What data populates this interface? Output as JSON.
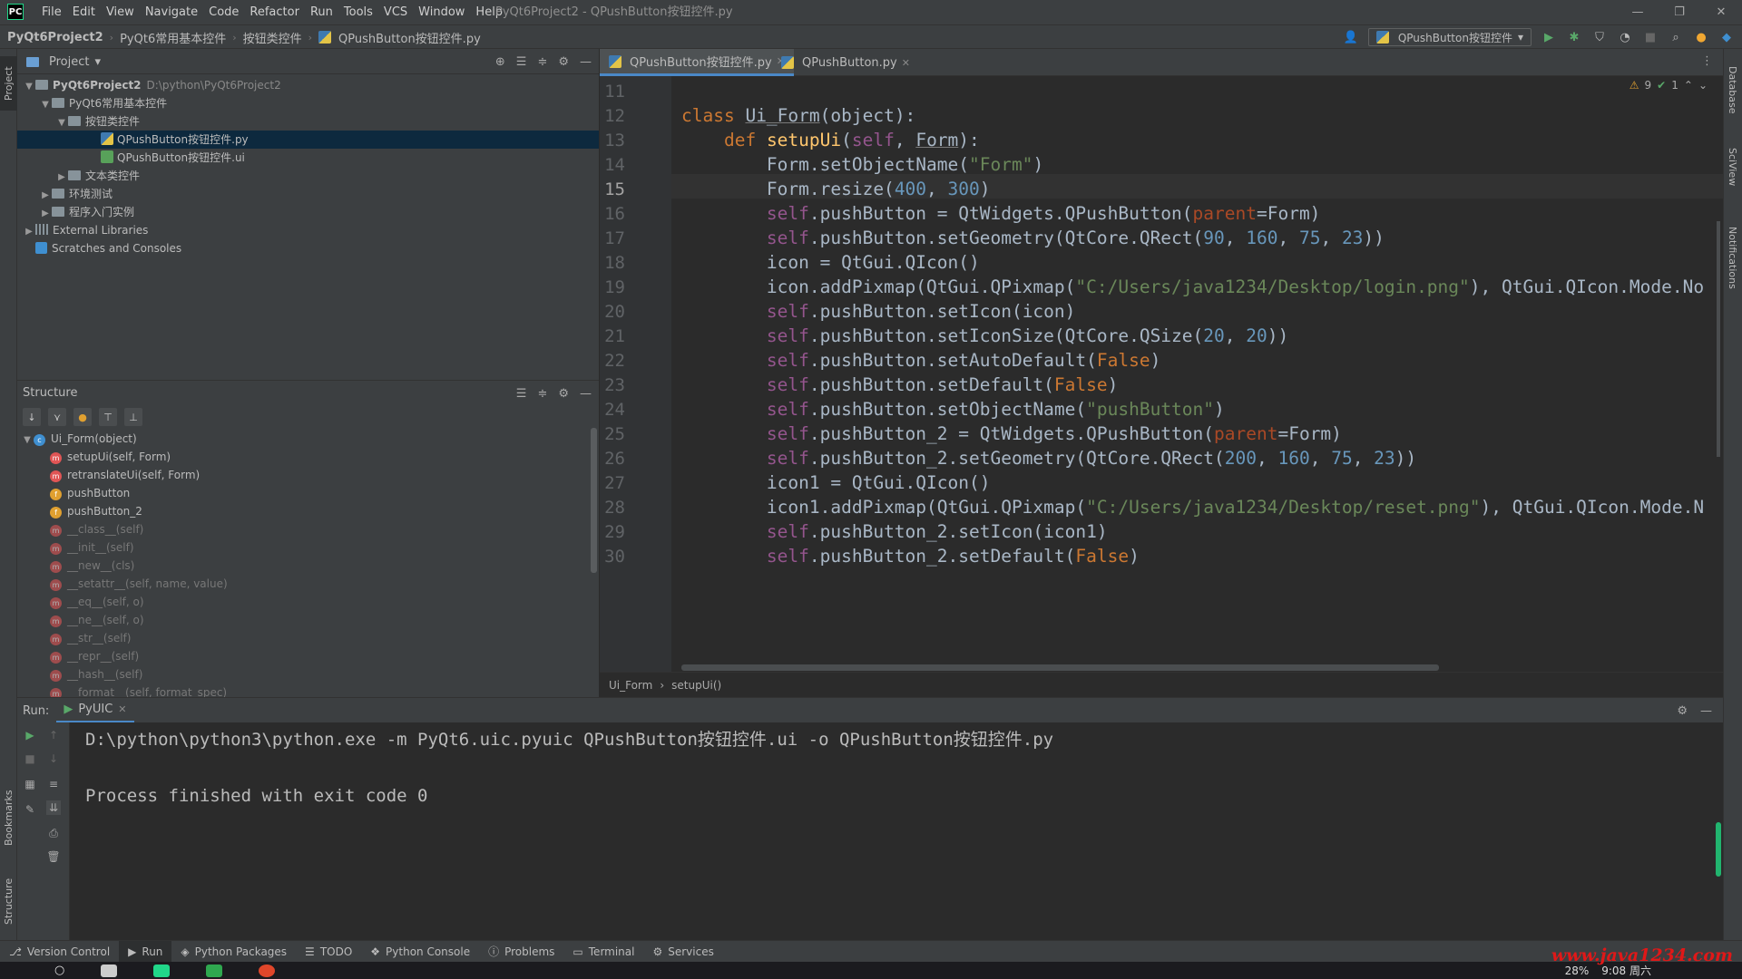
{
  "app": {
    "logo": "PC",
    "menu": [
      "File",
      "Edit",
      "View",
      "Navigate",
      "Code",
      "Refactor",
      "Run",
      "Tools",
      "VCS",
      "Window",
      "Help"
    ],
    "window_title": "PyQt6Project2 - QPushButton按钮控件.py",
    "win_controls": [
      "—",
      "❐",
      "✕"
    ]
  },
  "nav": {
    "breadcrumb": [
      "PyQt6Project2",
      "PyQt6常用基本控件",
      "按钮类控件",
      "QPushButton按钮控件.py"
    ],
    "run_config": "QPushButton按钮控件"
  },
  "project_panel": {
    "title": "Project",
    "tree": [
      {
        "label": "PyQt6Project2",
        "path": "D:\\python\\PyQt6Project2",
        "type": "folder",
        "indent": 0,
        "expanded": true,
        "bold": true
      },
      {
        "label": "PyQt6常用基本控件",
        "type": "folder",
        "indent": 1,
        "expanded": true
      },
      {
        "label": "按钮类控件",
        "type": "folder",
        "indent": 2,
        "expanded": true
      },
      {
        "label": "QPushButton按钮控件.py",
        "type": "py",
        "indent": 4,
        "selected": true
      },
      {
        "label": "QPushButton按钮控件.ui",
        "type": "ui",
        "indent": 4
      },
      {
        "label": "文本类控件",
        "type": "folder",
        "indent": 2,
        "expanded": false
      },
      {
        "label": "环境测试",
        "type": "folder",
        "indent": 1,
        "expanded": false
      },
      {
        "label": "程序入门实例",
        "type": "folder",
        "indent": 1,
        "expanded": false
      },
      {
        "label": "External Libraries",
        "type": "lib",
        "indent": 0,
        "expanded": false
      },
      {
        "label": "Scratches and Consoles",
        "type": "scratch",
        "indent": 0
      }
    ]
  },
  "structure_panel": {
    "title": "Structure",
    "items": [
      {
        "label": "Ui_Form(object)",
        "kind": "c",
        "indent": 0,
        "dim": false
      },
      {
        "label": "setupUi(self, Form)",
        "kind": "m",
        "indent": 1,
        "dim": false
      },
      {
        "label": "retranslateUi(self, Form)",
        "kind": "m",
        "indent": 1,
        "dim": false
      },
      {
        "label": "pushButton",
        "kind": "f",
        "indent": 1,
        "dim": false
      },
      {
        "label": "pushButton_2",
        "kind": "f",
        "indent": 1,
        "dim": false
      },
      {
        "label": "__class__(self)",
        "kind": "m",
        "indent": 1,
        "dim": true
      },
      {
        "label": "__init__(self)",
        "kind": "m",
        "indent": 1,
        "dim": true
      },
      {
        "label": "__new__(cls)",
        "kind": "m",
        "indent": 1,
        "dim": true
      },
      {
        "label": "__setattr__(self, name, value)",
        "kind": "m",
        "indent": 1,
        "dim": true
      },
      {
        "label": "__eq__(self, o)",
        "kind": "m",
        "indent": 1,
        "dim": true
      },
      {
        "label": "__ne__(self, o)",
        "kind": "m",
        "indent": 1,
        "dim": true
      },
      {
        "label": "__str__(self)",
        "kind": "m",
        "indent": 1,
        "dim": true
      },
      {
        "label": "__repr__(self)",
        "kind": "m",
        "indent": 1,
        "dim": true
      },
      {
        "label": "__hash__(self)",
        "kind": "m",
        "indent": 1,
        "dim": true
      },
      {
        "label": "__format__(self, format_spec)",
        "kind": "m",
        "indent": 1,
        "dim": true
      }
    ]
  },
  "editor": {
    "tabs": [
      {
        "label": "QPushButton按钮控件.py",
        "active": true
      },
      {
        "label": "QPushButton.py",
        "active": false
      }
    ],
    "inspection": {
      "warnings": "9",
      "ok": "1"
    },
    "current_line": 15,
    "lines": [
      {
        "n": 11,
        "tokens": []
      },
      {
        "n": 12,
        "tokens": [
          [
            "kw",
            "class "
          ],
          [
            "ul",
            "Ui_Form"
          ],
          [
            "p",
            "(object):"
          ]
        ]
      },
      {
        "n": 13,
        "tokens": [
          [
            "p",
            "    "
          ],
          [
            "kw",
            "def "
          ],
          [
            "fn",
            "setupUi"
          ],
          [
            "p",
            "("
          ],
          [
            "self",
            "self"
          ],
          [
            "p",
            ", "
          ],
          [
            "ul",
            "Form"
          ],
          [
            "p",
            "):"
          ]
        ]
      },
      {
        "n": 14,
        "tokens": [
          [
            "p",
            "        Form.setObjectName("
          ],
          [
            "str",
            "\"Form\""
          ],
          [
            "p",
            ")"
          ]
        ]
      },
      {
        "n": 15,
        "tokens": [
          [
            "p",
            "        Form.resize("
          ],
          [
            "num",
            "400"
          ],
          [
            "p",
            ", "
          ],
          [
            "num",
            "300"
          ],
          [
            "p",
            ")"
          ]
        ]
      },
      {
        "n": 16,
        "tokens": [
          [
            "p",
            "        "
          ],
          [
            "self",
            "self"
          ],
          [
            "p",
            ".pushButton = QtWidgets.QPushButton("
          ],
          [
            "param",
            "parent"
          ],
          [
            "p",
            "=Form)"
          ]
        ]
      },
      {
        "n": 17,
        "tokens": [
          [
            "p",
            "        "
          ],
          [
            "self",
            "self"
          ],
          [
            "p",
            ".pushButton.setGeometry(QtCore.QRect("
          ],
          [
            "num",
            "90"
          ],
          [
            "p",
            ", "
          ],
          [
            "num",
            "160"
          ],
          [
            "p",
            ", "
          ],
          [
            "num",
            "75"
          ],
          [
            "p",
            ", "
          ],
          [
            "num",
            "23"
          ],
          [
            "p",
            "))"
          ]
        ]
      },
      {
        "n": 18,
        "tokens": [
          [
            "p",
            "        icon = QtGui.QIcon()"
          ]
        ]
      },
      {
        "n": 19,
        "tokens": [
          [
            "p",
            "        icon.addPixmap(QtGui.QPixmap("
          ],
          [
            "str",
            "\"C:/Users/java1234/Desktop/login.png\""
          ],
          [
            "p",
            "), QtGui.QIcon.Mode.No"
          ]
        ]
      },
      {
        "n": 20,
        "tokens": [
          [
            "p",
            "        "
          ],
          [
            "self",
            "self"
          ],
          [
            "p",
            ".pushButton.setIcon(icon)"
          ]
        ]
      },
      {
        "n": 21,
        "tokens": [
          [
            "p",
            "        "
          ],
          [
            "self",
            "self"
          ],
          [
            "p",
            ".pushButton.setIconSize(QtCore.QSize("
          ],
          [
            "num",
            "20"
          ],
          [
            "p",
            ", "
          ],
          [
            "num",
            "20"
          ],
          [
            "p",
            "))"
          ]
        ]
      },
      {
        "n": 22,
        "tokens": [
          [
            "p",
            "        "
          ],
          [
            "self",
            "self"
          ],
          [
            "p",
            ".pushButton.setAutoDefault("
          ],
          [
            "kw",
            "False"
          ],
          [
            "p",
            ")"
          ]
        ]
      },
      {
        "n": 23,
        "tokens": [
          [
            "p",
            "        "
          ],
          [
            "self",
            "self"
          ],
          [
            "p",
            ".pushButton.setDefault("
          ],
          [
            "kw",
            "False"
          ],
          [
            "p",
            ")"
          ]
        ]
      },
      {
        "n": 24,
        "tokens": [
          [
            "p",
            "        "
          ],
          [
            "self",
            "self"
          ],
          [
            "p",
            ".pushButton.setObjectName("
          ],
          [
            "str",
            "\"pushButton\""
          ],
          [
            "p",
            ")"
          ]
        ]
      },
      {
        "n": 25,
        "tokens": [
          [
            "p",
            "        "
          ],
          [
            "self",
            "self"
          ],
          [
            "p",
            ".pushButton_2 = QtWidgets.QPushButton("
          ],
          [
            "param",
            "parent"
          ],
          [
            "p",
            "=Form)"
          ]
        ]
      },
      {
        "n": 26,
        "tokens": [
          [
            "p",
            "        "
          ],
          [
            "self",
            "self"
          ],
          [
            "p",
            ".pushButton_2.setGeometry(QtCore.QRect("
          ],
          [
            "num",
            "200"
          ],
          [
            "p",
            ", "
          ],
          [
            "num",
            "160"
          ],
          [
            "p",
            ", "
          ],
          [
            "num",
            "75"
          ],
          [
            "p",
            ", "
          ],
          [
            "num",
            "23"
          ],
          [
            "p",
            "))"
          ]
        ]
      },
      {
        "n": 27,
        "tokens": [
          [
            "p",
            "        icon1 = QtGui.QIcon()"
          ]
        ]
      },
      {
        "n": 28,
        "tokens": [
          [
            "p",
            "        icon1.addPixmap(QtGui.QPixmap("
          ],
          [
            "str",
            "\"C:/Users/java1234/Desktop/reset.png\""
          ],
          [
            "p",
            "), QtGui.QIcon.Mode.N"
          ]
        ]
      },
      {
        "n": 29,
        "tokens": [
          [
            "p",
            "        "
          ],
          [
            "self",
            "self"
          ],
          [
            "p",
            ".pushButton_2.setIcon(icon1)"
          ]
        ]
      },
      {
        "n": 30,
        "tokens": [
          [
            "p",
            "        "
          ],
          [
            "self",
            "self"
          ],
          [
            "p",
            ".pushButton_2.setDefault("
          ],
          [
            "kw",
            "False"
          ],
          [
            "p",
            ")"
          ]
        ]
      }
    ],
    "breadcrumb": [
      "Ui_Form",
      "setupUi()"
    ]
  },
  "run_panel": {
    "label": "Run:",
    "tab": "PyUIC",
    "console": [
      "D:\\python\\python3\\python.exe -m PyQt6.uic.pyuic QPushButton按钮控件.ui -o QPushButton按钮控件.py",
      "",
      "Process finished with exit code 0"
    ]
  },
  "side_strips": {
    "left": [
      "Project",
      "Bookmarks",
      "Structure"
    ],
    "right": [
      "Database",
      "SciView",
      "Notifications"
    ]
  },
  "bottom_tabs": [
    {
      "label": "Version Control",
      "icon": "branch-icon",
      "active": false
    },
    {
      "label": "Run",
      "icon": "play-icon",
      "active": true
    },
    {
      "label": "Python Packages",
      "icon": "package-icon",
      "active": false
    },
    {
      "label": "TODO",
      "icon": "list-icon",
      "active": false
    },
    {
      "label": "Python Console",
      "icon": "python-icon",
      "active": false
    },
    {
      "label": "Problems",
      "icon": "info-icon",
      "active": false
    },
    {
      "label": "Terminal",
      "icon": "terminal-icon",
      "active": false
    },
    {
      "label": "Services",
      "icon": "services-icon",
      "active": false
    }
  ],
  "taskbar": {
    "battery": "28%",
    "time": "9:08 周六"
  },
  "watermark": "www.java1234.com",
  "colors": {
    "accent": "#4a88c7",
    "keyword": "#cc7832",
    "string": "#6a8759",
    "number": "#6897bb",
    "function": "#ffc66d",
    "self": "#94558d"
  }
}
